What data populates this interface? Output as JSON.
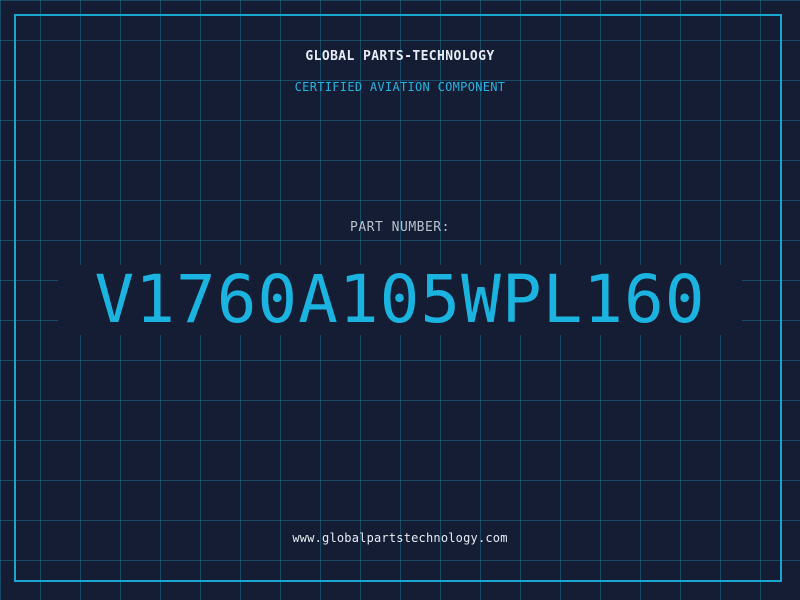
{
  "header": {
    "company": "GLOBAL PARTS-TECHNOLOGY",
    "subtitle": "CERTIFIED AVIATION COMPONENT"
  },
  "part": {
    "label": "PART NUMBER:",
    "number": "V1760A105WPL160"
  },
  "footer": {
    "website": "www.globalpartstechnology.com"
  },
  "colors": {
    "background": "#141d33",
    "grid": "#2196be",
    "accent": "#1bb3e0",
    "text": "#e6edf5",
    "muted": "#b8c2cf"
  }
}
